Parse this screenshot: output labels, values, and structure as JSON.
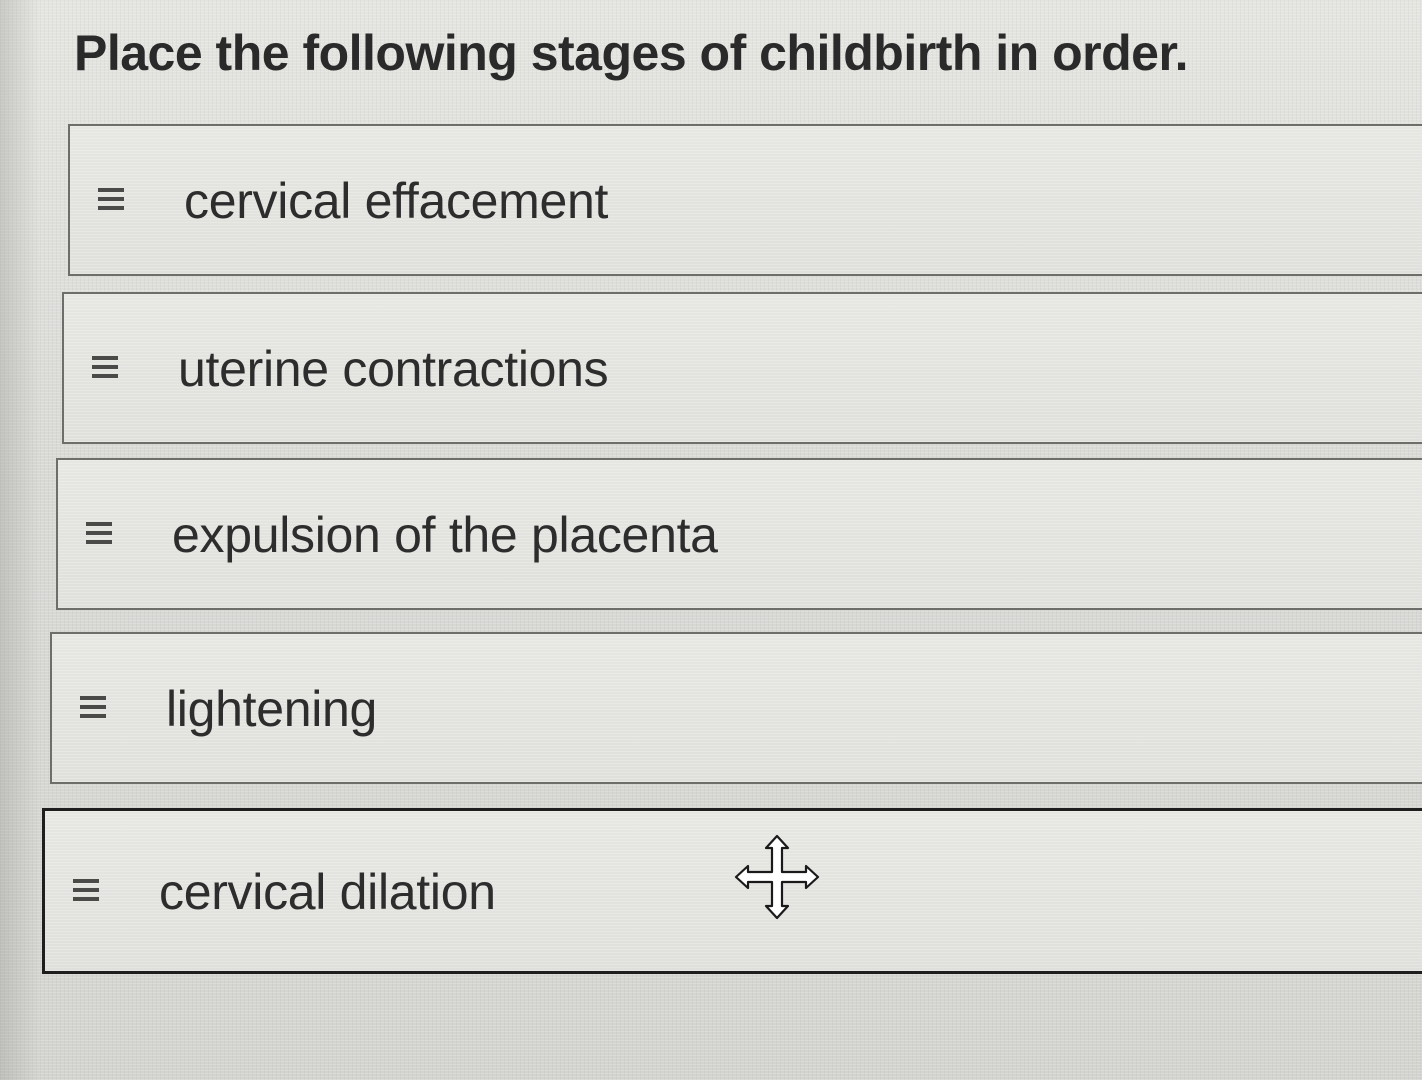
{
  "question": {
    "prompt": "Place the following stages of childbirth in order."
  },
  "items": [
    {
      "label": "cervical effacement",
      "handle_icon": "drag-handle-icon"
    },
    {
      "label": "uterine contractions",
      "handle_icon": "drag-handle-icon"
    },
    {
      "label": "expulsion of the placenta",
      "handle_icon": "drag-handle-icon"
    },
    {
      "label": "lightening",
      "handle_icon": "drag-handle-icon"
    },
    {
      "label": "cervical dilation",
      "handle_icon": "drag-handle-icon",
      "active": true
    }
  ],
  "cursor": {
    "icon": "move-cursor-icon"
  },
  "colors": {
    "background": "#dadad7",
    "item_border": "#6d6d6a",
    "active_border": "#1e1e1e",
    "text": "#2d2d2d"
  }
}
